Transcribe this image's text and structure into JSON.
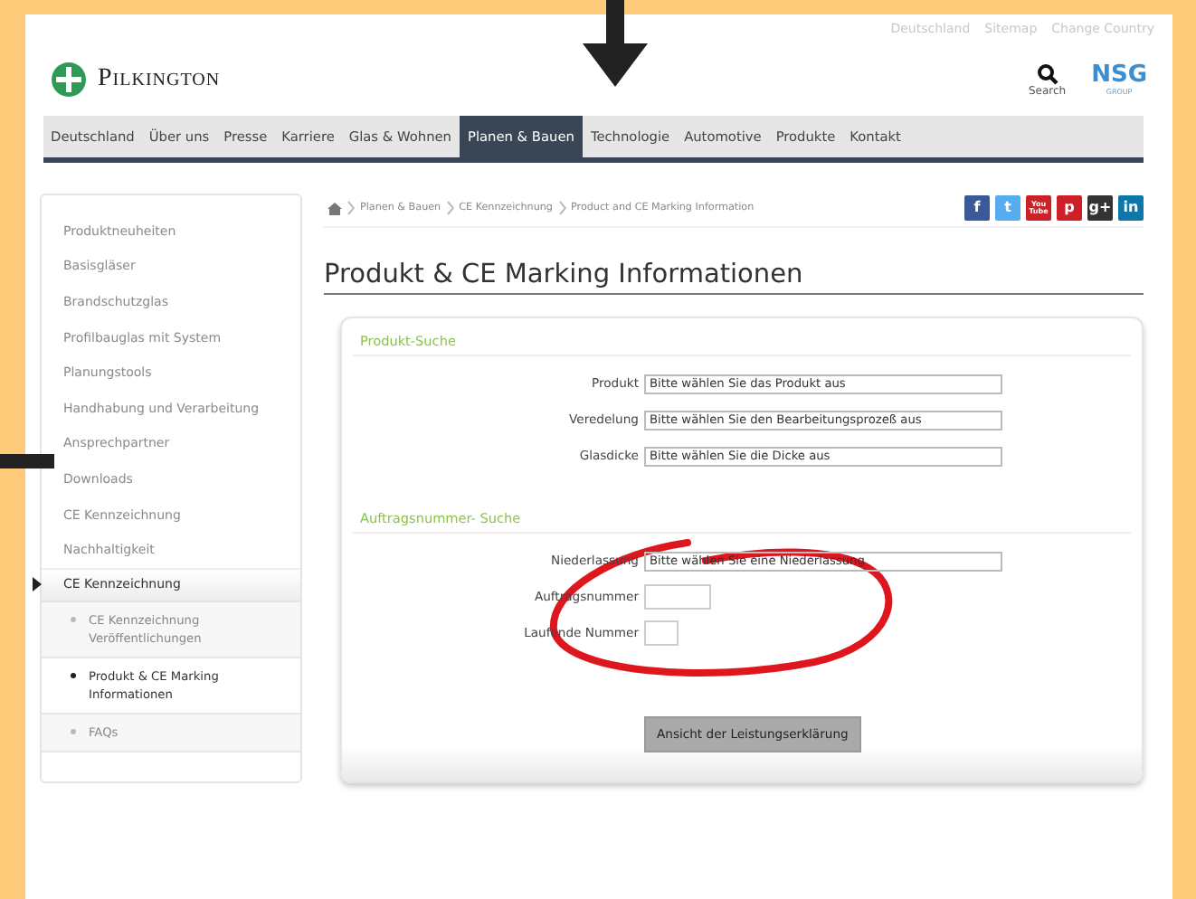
{
  "header": {
    "top_links": [
      "Deutschland",
      "Sitemap",
      "Change Country"
    ],
    "logo": "Pilkington",
    "search_label": "Search",
    "group_logo": "NSG",
    "group_sub": "GROUP"
  },
  "nav": [
    {
      "label": "Deutschland",
      "selected": false
    },
    {
      "label": "Über uns",
      "selected": false
    },
    {
      "label": "Presse",
      "selected": false
    },
    {
      "label": "Karriere",
      "selected": false
    },
    {
      "label": "Glas & Wohnen",
      "selected": false
    },
    {
      "label": "Planen & Bauen",
      "selected": true
    },
    {
      "label": "Technologie",
      "selected": false
    },
    {
      "label": "Automotive",
      "selected": false
    },
    {
      "label": "Produkte",
      "selected": false
    },
    {
      "label": "Kontakt",
      "selected": false
    }
  ],
  "sidebar": {
    "items": [
      {
        "label": "Produktneuheiten",
        "kind": "link",
        "selected": false
      },
      {
        "label": "Basisgläser",
        "kind": "link",
        "selected": false
      },
      {
        "label": "Brandschutzglas",
        "kind": "link",
        "selected": false
      },
      {
        "label": "Profilbauglas mit System",
        "kind": "link",
        "selected": false
      },
      {
        "label": "Planungstools",
        "kind": "link",
        "selected": false
      },
      {
        "label": "Handhabung und Verarbeitung",
        "kind": "link",
        "selected": false
      },
      {
        "label": "Ansprechpartner",
        "kind": "link",
        "selected": false
      },
      {
        "label": "Downloads",
        "kind": "link",
        "selected": false
      },
      {
        "label": "CE Kennzeichnung",
        "kind": "link",
        "selected": false
      },
      {
        "label": "Nachhaltigkeit",
        "kind": "link",
        "selected": false
      },
      {
        "label": "CE Kennzeichnung",
        "kind": "section",
        "selected": true
      },
      {
        "label": "CE Kennzeichnung Veröffentlichungen",
        "kind": "sub",
        "selected": false
      },
      {
        "label": "Produkt & CE Marking Informationen",
        "kind": "sub",
        "selected": true
      },
      {
        "label": "FAQs",
        "kind": "sub",
        "selected": false
      }
    ]
  },
  "breadcrumb": [
    "Planen & Bauen",
    "CE Kennzeichnung",
    "Product and CE Marking Information"
  ],
  "social": [
    {
      "glyph": "f",
      "color": "#3b5998"
    },
    {
      "glyph": "t",
      "color": "#55acee"
    },
    {
      "glyph": "You Tube",
      "color": "#cc2127"
    },
    {
      "glyph": "p",
      "color": "#cb2027"
    },
    {
      "glyph": "g+",
      "color": "#333333"
    },
    {
      "glyph": "in",
      "color": "#0e76a8"
    }
  ],
  "title": "Produkt & CE Marking Informationen",
  "sections": [
    {
      "title": "Produkt-Suche",
      "fields": [
        {
          "label": "Produkt",
          "kind": "select",
          "value": "Bitte wählen Sie das Produkt aus"
        },
        {
          "label": "Veredelung",
          "kind": "select",
          "value": "Bitte wählen Sie den Bearbeitungsprozeß aus"
        },
        {
          "label": "Glasdicke",
          "kind": "select",
          "value": "Bitte wählen Sie die Dicke aus"
        }
      ]
    },
    {
      "title": "Auftragsnummer- Suche",
      "fields": [
        {
          "label": "Niederlassung",
          "kind": "select",
          "value": "Bitte wählen Sie eine Niederlassung"
        },
        {
          "label": "Auftragsnummer",
          "kind": "input"
        },
        {
          "label": "Laufende Nummer",
          "kind": "short"
        }
      ]
    }
  ],
  "button": "Ansicht der Leistungserklärung",
  "annotations": [
    {
      "kind": "down-arrow"
    },
    {
      "kind": "bar"
    },
    {
      "kind": "ellipse"
    }
  ]
}
